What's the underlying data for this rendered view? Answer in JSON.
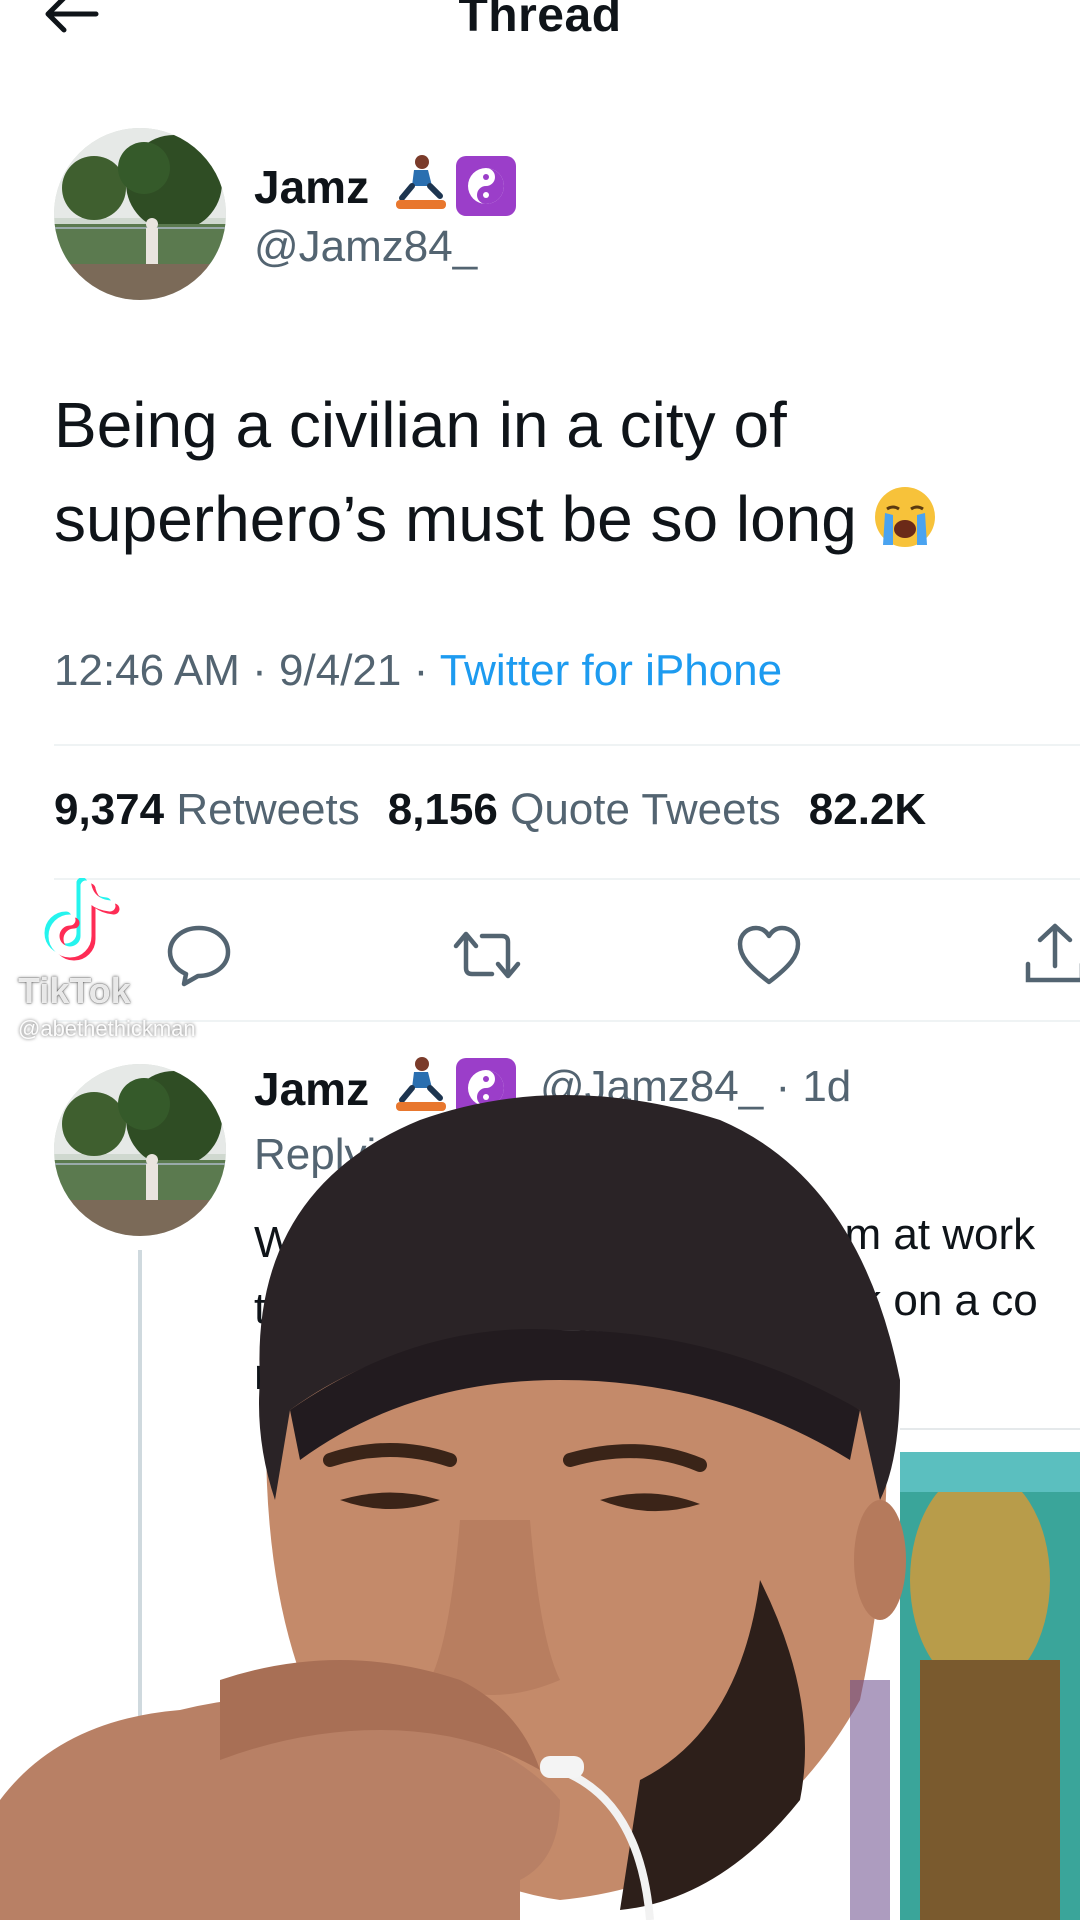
{
  "header": {
    "title": "Thread",
    "back_icon": "back-arrow-icon"
  },
  "tweet": {
    "author": {
      "name": "Jamz",
      "handle": "@Jamz84_",
      "badges": [
        "skateboarder-emoji",
        "yin-yang-emoji"
      ]
    },
    "text_line1": "Being a civilian in a city of",
    "text_line2": "superhero’s must be so long",
    "emoji": "loudly-crying-face",
    "time": "12:46 AM",
    "date": "9/4/21",
    "separator": "·",
    "source": "Twitter for iPhone",
    "stats": {
      "retweets_count": "9,374",
      "retweets_label": "Retweets",
      "quotes_count": "8,156",
      "quotes_label": "Quote Tweets",
      "likes_count": "82.2K"
    },
    "actions": [
      "reply-icon",
      "retweet-icon",
      "like-icon",
      "share-icon"
    ]
  },
  "watermark": {
    "brand": "TikTok",
    "user": "@abethethickman"
  },
  "reply": {
    "author_name": "Jamz",
    "handle": "@Jamz84_",
    "age": "· 1d",
    "replying_label": "Replyin",
    "line1_left": "Wal",
    "line1_right": "om at work",
    "line2_left": "th",
    "line2_right": "ark on a co",
    "line3_left": "m"
  },
  "colors": {
    "text": "#0f1419",
    "secondary": "#536471",
    "link": "#1d9bf0",
    "divider": "#eff3f4",
    "badge_purple": "#9b3ec9"
  }
}
